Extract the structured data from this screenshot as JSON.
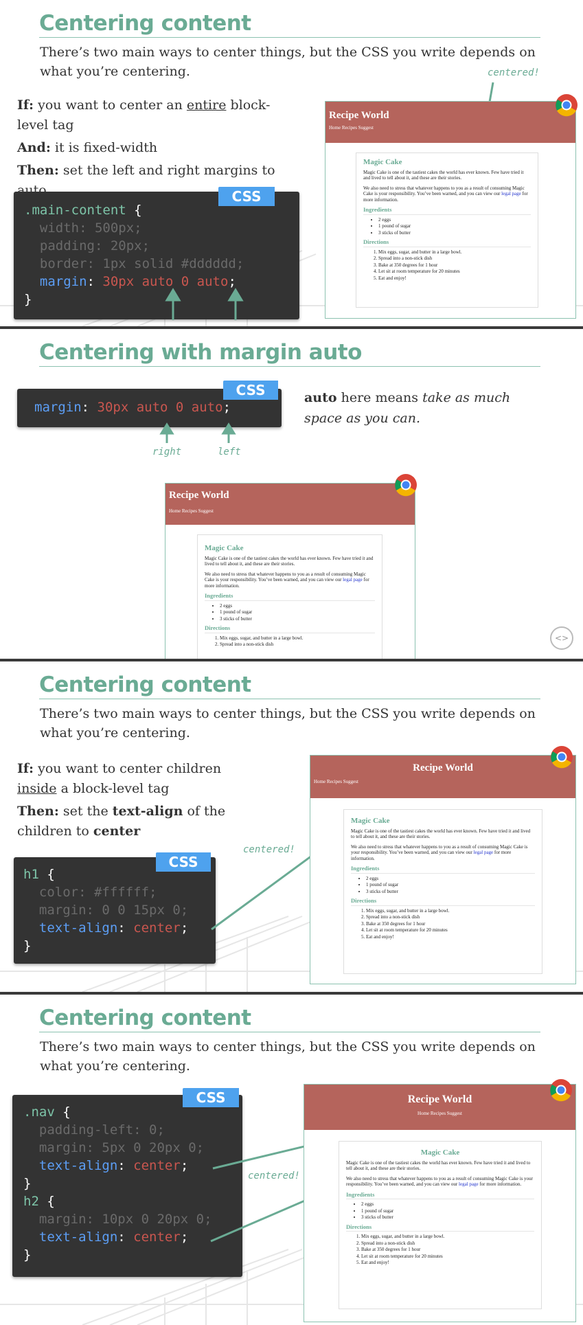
{
  "slides": [
    {
      "title": "Centering content",
      "subtitle": "There’s two main ways to center things, but the CSS you write depends on what you’re centering.",
      "if_label": "If:",
      "if_text_a": " you want to center an ",
      "if_text_u": "entire",
      "if_text_b": " block-level tag",
      "and_label": "And:",
      "and_text": " it is fixed-width",
      "then_label": "Then:",
      "then_text": " set the left and right margins to auto",
      "css_badge": "CSS",
      "code": {
        "selector": ".main-content",
        "open": " {",
        "l1": "  width: 500px;",
        "l2": "  padding: 20px;",
        "l3": "  border: 1px solid #dddddd;",
        "l4_prop": "  margin",
        "l4_colon": ": ",
        "l4_val": "30px auto 0 auto",
        "l4_end": ";",
        "close": "}"
      },
      "annotation": "centered!"
    },
    {
      "title": "Centering with margin auto",
      "css_badge": "CSS",
      "code": {
        "prop": "margin",
        "colon": ": ",
        "val": "30px auto 0 auto",
        "end": ";"
      },
      "auto_word": "auto",
      "auto_text": " here means ",
      "auto_em": "take as much space as you can.",
      "right_label": "right",
      "left_label": "left",
      "nav_icon": "<>"
    },
    {
      "title": "Centering content",
      "subtitle": "There’s two main ways to center things, but the CSS you write depends on what you’re centering.",
      "if_label": "If:",
      "if_text_a": " you want to center children ",
      "if_text_u": "inside",
      "if_text_b": " a block-level tag",
      "then_label": "Then:",
      "then_text_a": " set the ",
      "then_bold": "text-align",
      "then_text_b": " of the children to ",
      "then_bold2": "center",
      "css_badge": "CSS",
      "code": {
        "selector": "h1",
        "open": " {",
        "l1": "  color: #ffffff;",
        "l2": "  margin: 0 0 15px 0;",
        "l3_prop": "  text-align",
        "l3_colon": ": ",
        "l3_val": "center",
        "l3_end": ";",
        "close": "}"
      },
      "annotation": "centered!"
    },
    {
      "title": "Centering content",
      "subtitle": "There’s two main ways to center things, but the CSS you write depends on what you’re centering.",
      "css_badge": "CSS",
      "code": {
        "sel1": ".nav",
        "open1": " {",
        "a1": "  padding-left: 0;",
        "a2": "  margin: 5px 0 20px 0;",
        "a3_prop": "  text-align",
        "a3_colon": ": ",
        "a3_val": "center",
        "a3_end": ";",
        "close1": "}",
        "sel2": "h2",
        "open2": " {",
        "b1": "  margin: 10px 0 20px 0;",
        "b2_prop": "  text-align",
        "b2_colon": ": ",
        "b2_val": "center",
        "b2_end": ";",
        "close2": "}"
      },
      "annotation": "centered!"
    }
  ],
  "mock": {
    "site_title": "Recipe World",
    "nav": "Home Recipes Suggest",
    "card_title": "Magic Cake",
    "p1": "Magic Cake is one of the tastiest cakes the world has ever known. Few have tried it and lived to tell about it, and these are their stories.",
    "p2a": "We also need to stress that whatever happens to you as a result of consuming Magic Cake is your responsibility. You’ve been warned, and you can view our ",
    "p2_link": "legal page",
    "p2b": " for more information.",
    "ingredients_heading": "Ingredients",
    "ingredients": [
      "2 eggs",
      "1 pound of sugar",
      "3 sticks of butter"
    ],
    "directions_heading": "Directions",
    "directions": [
      "Mix eggs, sugar, and butter in a large bowl.",
      "Spread into a non-stick dish",
      "Bake at 350 degrees for 1 hour",
      "Let sit at room temperature for 20 minutes",
      "Eat and enjoy!"
    ]
  },
  "colors": {
    "accent": "#6aab94",
    "header": "#b5645c",
    "code_bg": "#333333",
    "badge": "#4ea2ee",
    "prop": "#5c9ef5",
    "val": "#c9564f"
  }
}
